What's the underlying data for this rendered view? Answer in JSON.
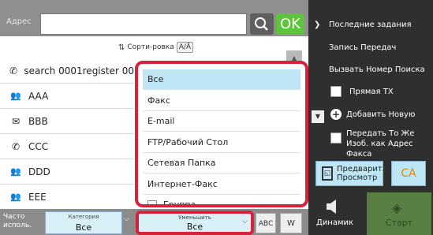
{
  "topbar": {
    "address_label": "Адрес",
    "ok_label": "OK",
    "address_value": ""
  },
  "list": {
    "sort_label": "Сорти-ровка",
    "sort_button": "A/Ā",
    "entries": [
      {
        "name": "search 0001register 00",
        "icon": "phone-icon"
      },
      {
        "name": "AAA",
        "icon": "group-icon"
      },
      {
        "name": "BBB",
        "icon": "envelope-icon"
      },
      {
        "name": "CCC",
        "icon": "phone-icon"
      },
      {
        "name": "DDD",
        "icon": "group-icon"
      },
      {
        "name": "EEE",
        "icon": "group-red-icon"
      }
    ]
  },
  "dropdown": {
    "options": [
      "Все",
      "Факс",
      "E-mail",
      "FTP/Рабочий Стол",
      "Сетевая Папка",
      "Интернет-Факс",
      "Группа"
    ],
    "selected": "Все"
  },
  "bottom": {
    "frequent_label": "Часто исполь.",
    "category_title": "Категория",
    "category_value": "Все",
    "reduce_title": "Уменьшить",
    "reduce_value": "Все",
    "abc_label": "ABC",
    "w_label": "W"
  },
  "right": {
    "menu": {
      "recent_jobs": "Последние задания",
      "send_log": "Запись Передач",
      "call_search": "Вызвать Номер Поиска",
      "direct_tx": "Прямая ТХ",
      "add_new": "Добавить Новую",
      "send_same": "Передать То Же Изоб. как Адрес Факса"
    },
    "preview_label": "Предварит. Просмотр",
    "ca_label": "CA",
    "speaker_label": "Динамик",
    "start_label": "Старт"
  },
  "colors": {
    "accent_red": "#d6223a",
    "ok_green": "#5dc43b",
    "selected_blue": "#bfe6f5"
  }
}
